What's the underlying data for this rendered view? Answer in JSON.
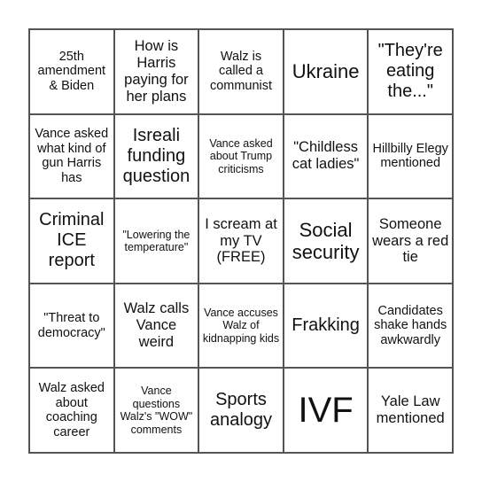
{
  "board": {
    "rows": [
      [
        {
          "text": "25th amendment & Biden",
          "size": "s-s"
        },
        {
          "text": "How is Harris paying for her plans",
          "size": "s-m"
        },
        {
          "text": "Walz is called a communist",
          "size": "s-s"
        },
        {
          "text": "Ukraine",
          "size": "s-xl"
        },
        {
          "text": "\"They're eating the...\"",
          "size": "s-l"
        }
      ],
      [
        {
          "text": "Vance asked what kind of gun Harris has",
          "size": "s-s"
        },
        {
          "text": "Isreali funding question",
          "size": "s-l"
        },
        {
          "text": "Vance asked about Trump criticisms",
          "size": "s-xs"
        },
        {
          "text": "\"Childless cat ladies\"",
          "size": "s-m"
        },
        {
          "text": "Hillbilly Elegy mentioned",
          "size": "s-s"
        }
      ],
      [
        {
          "text": "Criminal ICE report",
          "size": "s-l"
        },
        {
          "text": "\"Lowering the temperature\"",
          "size": "s-xs"
        },
        {
          "text": "I scream at my TV (FREE)",
          "size": "s-m"
        },
        {
          "text": "Social security",
          "size": "s-xl"
        },
        {
          "text": "Someone wears a red tie",
          "size": "s-m"
        }
      ],
      [
        {
          "text": "\"Threat to democracy\"",
          "size": "s-s"
        },
        {
          "text": "Walz calls Vance weird",
          "size": "s-m"
        },
        {
          "text": "Vance accuses Walz of kidnapping kids",
          "size": "s-xs"
        },
        {
          "text": "Frakking",
          "size": "s-l"
        },
        {
          "text": "Candidates shake hands awkwardly",
          "size": "s-s"
        }
      ],
      [
        {
          "text": "Walz asked about coaching career",
          "size": "s-s"
        },
        {
          "text": "Vance questions Walz's \"WOW\" comments",
          "size": "s-xs"
        },
        {
          "text": "Sports analogy",
          "size": "s-l"
        },
        {
          "text": "IVF",
          "size": "s-xxl"
        },
        {
          "text": "Yale Law mentioned",
          "size": "s-m"
        }
      ]
    ]
  }
}
